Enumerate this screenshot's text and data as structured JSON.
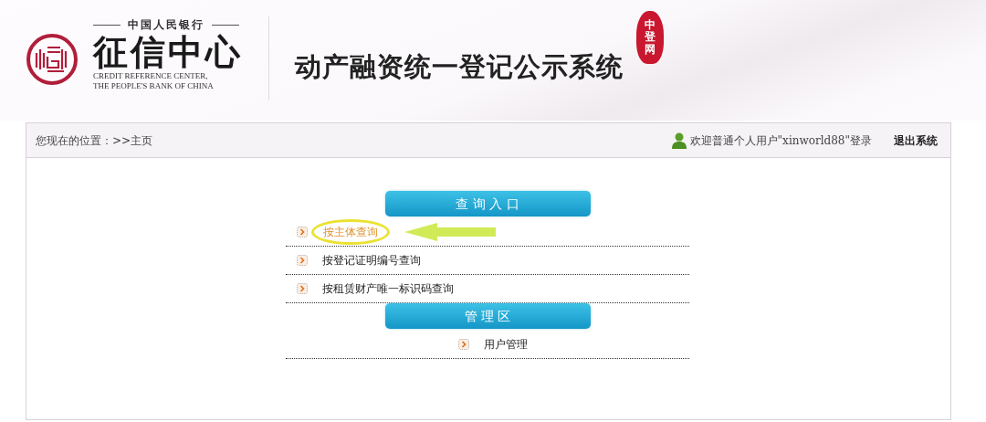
{
  "header": {
    "tagline": "中国人民银行",
    "org_name": "征信中心",
    "org_english": [
      "CREDIT REFERENCE CENTER,",
      "THE PEOPLE'S BANK OF CHINA"
    ],
    "system_title": "动产融资统一登记公示系统",
    "stamp": "中登网"
  },
  "topbar": {
    "breadcrumb": "您现在的位置：>>主页",
    "welcome": "欢迎普通个人用户\"xinworld88\"登录",
    "logout": "退出系统"
  },
  "sections": [
    {
      "title": "查 询 入 口",
      "kind": "list",
      "items": [
        {
          "label": "按主体查询",
          "highlighted": true
        },
        {
          "label": "按登记证明编号查询",
          "highlighted": false
        },
        {
          "label": "按租赁财产唯一标识码查询",
          "highlighted": false
        }
      ]
    },
    {
      "title": "管 理 区",
      "kind": "centered",
      "items": [
        {
          "label": "用户管理",
          "highlighted": false
        }
      ]
    }
  ]
}
